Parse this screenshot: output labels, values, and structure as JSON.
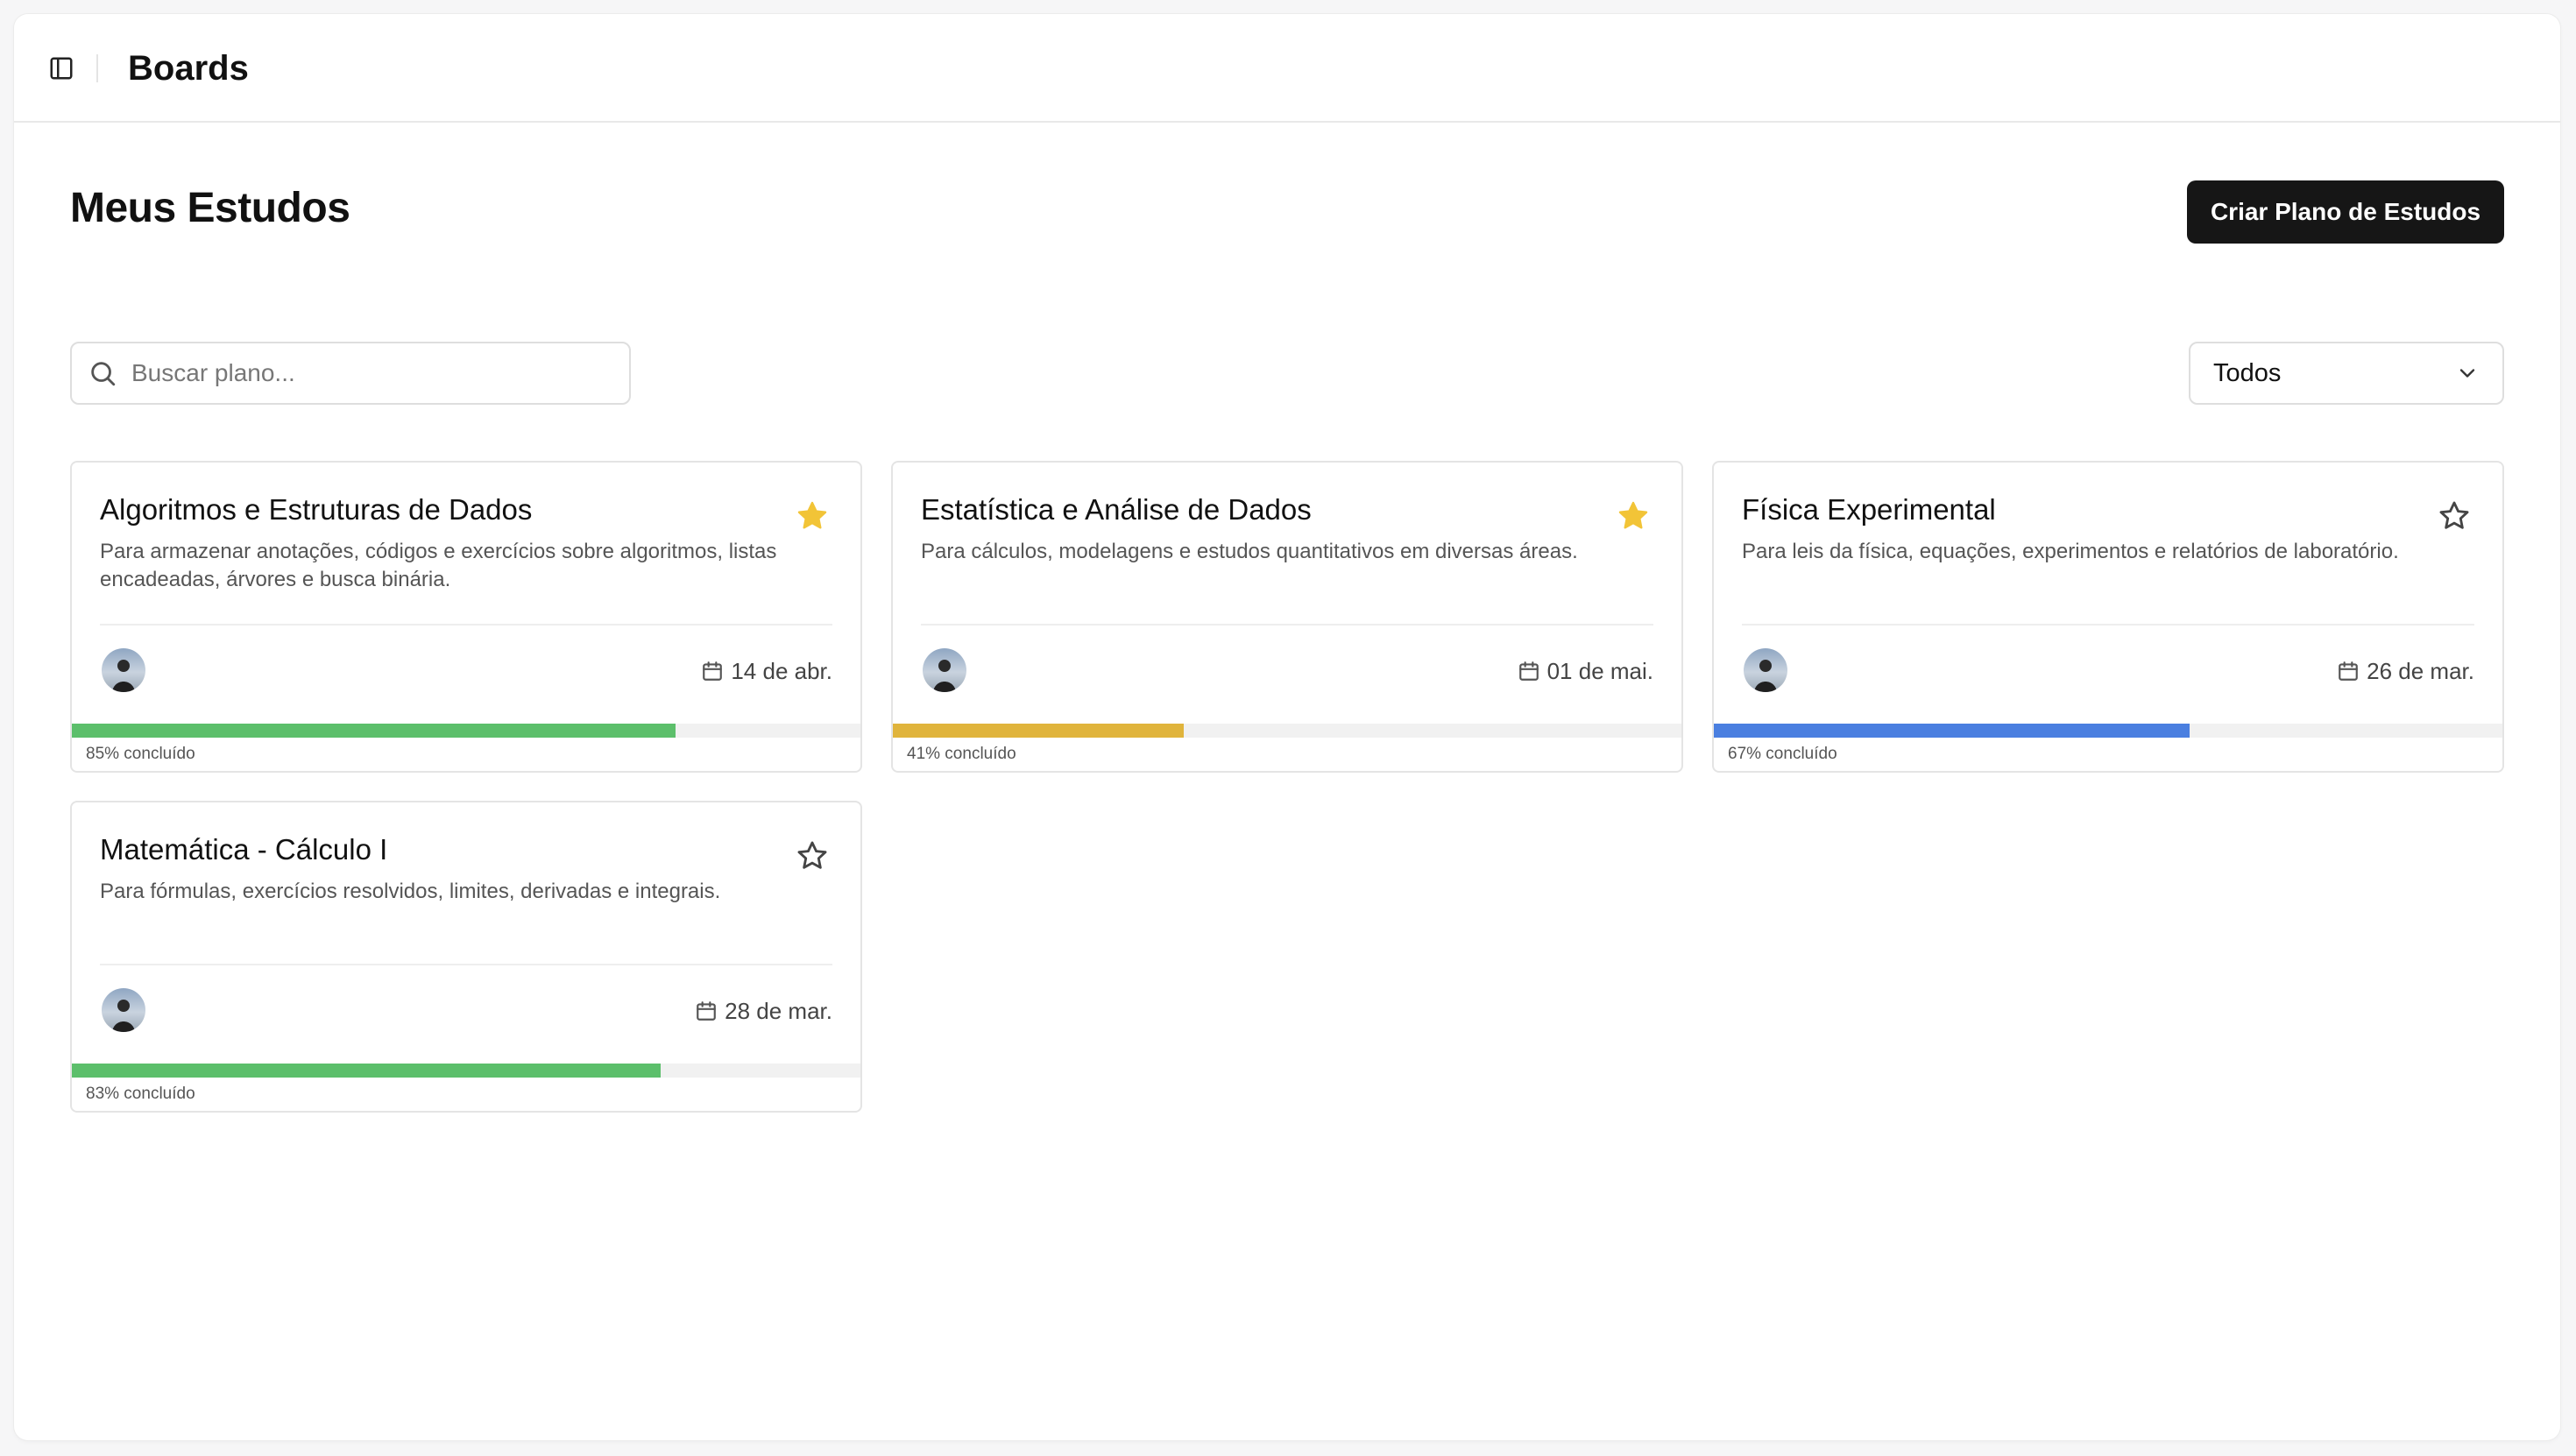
{
  "header": {
    "title": "Boards",
    "sidebar_icon": "sidebar-toggle-icon"
  },
  "page": {
    "title": "Meus Estudos",
    "create_button": "Criar Plano de Estudos"
  },
  "search": {
    "placeholder": "Buscar plano...",
    "value": "",
    "icon": "search-icon"
  },
  "filter": {
    "selected": "Todos",
    "icon": "chevron-down-icon"
  },
  "colors": {
    "green": "#5cbf6b",
    "yellow": "#e0b43c",
    "blue": "#4a7fe0",
    "star": "#f2c437"
  },
  "cards": [
    {
      "title": "Algoritmos e Estruturas de Dados",
      "description": "Para armazenar anotações, códigos e exercícios sobre algoritmos, listas encadeadas, árvores e busca binária.",
      "starred": true,
      "date": "14 de abr.",
      "progress": 85,
      "progress_label": "85% concluído",
      "color": "#5cbf6b"
    },
    {
      "title": "Estatística e Análise de Dados",
      "description": "Para cálculos, modelagens e estudos quantitativos em diversas áreas.",
      "starred": true,
      "date": "01 de mai.",
      "progress": 41,
      "progress_label": "41% concluído",
      "color": "#e0b43c"
    },
    {
      "title": "Física Experimental",
      "description": "Para leis da física, equações, experimentos e relatórios de laboratório.",
      "starred": false,
      "date": "26 de mar.",
      "progress": 67,
      "progress_label": "67% concluído",
      "color": "#4a7fe0"
    },
    {
      "title": "Matemática - Cálculo I",
      "description": "Para fórmulas, exercícios resolvidos, limites, derivadas e integrais.",
      "starred": false,
      "date": "28 de mar.",
      "progress": 83,
      "progress_label": "83% concluído",
      "color": "#5cbf6b"
    }
  ]
}
